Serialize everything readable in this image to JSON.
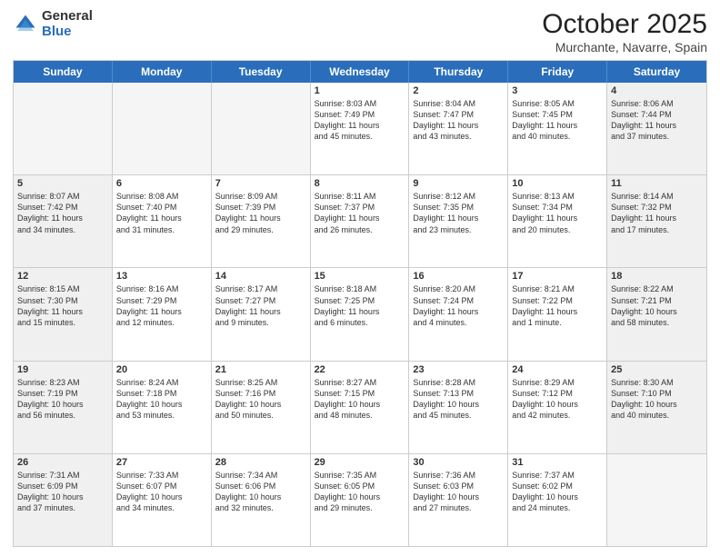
{
  "header": {
    "logo_general": "General",
    "logo_blue": "Blue",
    "title": "October 2025",
    "location": "Murchante, Navarre, Spain"
  },
  "weekdays": [
    "Sunday",
    "Monday",
    "Tuesday",
    "Wednesday",
    "Thursday",
    "Friday",
    "Saturday"
  ],
  "rows": [
    [
      {
        "day": "",
        "text": "",
        "empty": true
      },
      {
        "day": "",
        "text": "",
        "empty": true
      },
      {
        "day": "",
        "text": "",
        "empty": true
      },
      {
        "day": "1",
        "text": "Sunrise: 8:03 AM\nSunset: 7:49 PM\nDaylight: 11 hours\nand 45 minutes.",
        "empty": false
      },
      {
        "day": "2",
        "text": "Sunrise: 8:04 AM\nSunset: 7:47 PM\nDaylight: 11 hours\nand 43 minutes.",
        "empty": false
      },
      {
        "day": "3",
        "text": "Sunrise: 8:05 AM\nSunset: 7:45 PM\nDaylight: 11 hours\nand 40 minutes.",
        "empty": false
      },
      {
        "day": "4",
        "text": "Sunrise: 8:06 AM\nSunset: 7:44 PM\nDaylight: 11 hours\nand 37 minutes.",
        "empty": false,
        "shaded": true
      }
    ],
    [
      {
        "day": "5",
        "text": "Sunrise: 8:07 AM\nSunset: 7:42 PM\nDaylight: 11 hours\nand 34 minutes.",
        "empty": false,
        "shaded": true
      },
      {
        "day": "6",
        "text": "Sunrise: 8:08 AM\nSunset: 7:40 PM\nDaylight: 11 hours\nand 31 minutes.",
        "empty": false
      },
      {
        "day": "7",
        "text": "Sunrise: 8:09 AM\nSunset: 7:39 PM\nDaylight: 11 hours\nand 29 minutes.",
        "empty": false
      },
      {
        "day": "8",
        "text": "Sunrise: 8:11 AM\nSunset: 7:37 PM\nDaylight: 11 hours\nand 26 minutes.",
        "empty": false
      },
      {
        "day": "9",
        "text": "Sunrise: 8:12 AM\nSunset: 7:35 PM\nDaylight: 11 hours\nand 23 minutes.",
        "empty": false
      },
      {
        "day": "10",
        "text": "Sunrise: 8:13 AM\nSunset: 7:34 PM\nDaylight: 11 hours\nand 20 minutes.",
        "empty": false
      },
      {
        "day": "11",
        "text": "Sunrise: 8:14 AM\nSunset: 7:32 PM\nDaylight: 11 hours\nand 17 minutes.",
        "empty": false,
        "shaded": true
      }
    ],
    [
      {
        "day": "12",
        "text": "Sunrise: 8:15 AM\nSunset: 7:30 PM\nDaylight: 11 hours\nand 15 minutes.",
        "empty": false,
        "shaded": true
      },
      {
        "day": "13",
        "text": "Sunrise: 8:16 AM\nSunset: 7:29 PM\nDaylight: 11 hours\nand 12 minutes.",
        "empty": false
      },
      {
        "day": "14",
        "text": "Sunrise: 8:17 AM\nSunset: 7:27 PM\nDaylight: 11 hours\nand 9 minutes.",
        "empty": false
      },
      {
        "day": "15",
        "text": "Sunrise: 8:18 AM\nSunset: 7:25 PM\nDaylight: 11 hours\nand 6 minutes.",
        "empty": false
      },
      {
        "day": "16",
        "text": "Sunrise: 8:20 AM\nSunset: 7:24 PM\nDaylight: 11 hours\nand 4 minutes.",
        "empty": false
      },
      {
        "day": "17",
        "text": "Sunrise: 8:21 AM\nSunset: 7:22 PM\nDaylight: 11 hours\nand 1 minute.",
        "empty": false
      },
      {
        "day": "18",
        "text": "Sunrise: 8:22 AM\nSunset: 7:21 PM\nDaylight: 10 hours\nand 58 minutes.",
        "empty": false,
        "shaded": true
      }
    ],
    [
      {
        "day": "19",
        "text": "Sunrise: 8:23 AM\nSunset: 7:19 PM\nDaylight: 10 hours\nand 56 minutes.",
        "empty": false,
        "shaded": true
      },
      {
        "day": "20",
        "text": "Sunrise: 8:24 AM\nSunset: 7:18 PM\nDaylight: 10 hours\nand 53 minutes.",
        "empty": false
      },
      {
        "day": "21",
        "text": "Sunrise: 8:25 AM\nSunset: 7:16 PM\nDaylight: 10 hours\nand 50 minutes.",
        "empty": false
      },
      {
        "day": "22",
        "text": "Sunrise: 8:27 AM\nSunset: 7:15 PM\nDaylight: 10 hours\nand 48 minutes.",
        "empty": false
      },
      {
        "day": "23",
        "text": "Sunrise: 8:28 AM\nSunset: 7:13 PM\nDaylight: 10 hours\nand 45 minutes.",
        "empty": false
      },
      {
        "day": "24",
        "text": "Sunrise: 8:29 AM\nSunset: 7:12 PM\nDaylight: 10 hours\nand 42 minutes.",
        "empty": false
      },
      {
        "day": "25",
        "text": "Sunrise: 8:30 AM\nSunset: 7:10 PM\nDaylight: 10 hours\nand 40 minutes.",
        "empty": false,
        "shaded": true
      }
    ],
    [
      {
        "day": "26",
        "text": "Sunrise: 7:31 AM\nSunset: 6:09 PM\nDaylight: 10 hours\nand 37 minutes.",
        "empty": false,
        "shaded": true
      },
      {
        "day": "27",
        "text": "Sunrise: 7:33 AM\nSunset: 6:07 PM\nDaylight: 10 hours\nand 34 minutes.",
        "empty": false
      },
      {
        "day": "28",
        "text": "Sunrise: 7:34 AM\nSunset: 6:06 PM\nDaylight: 10 hours\nand 32 minutes.",
        "empty": false
      },
      {
        "day": "29",
        "text": "Sunrise: 7:35 AM\nSunset: 6:05 PM\nDaylight: 10 hours\nand 29 minutes.",
        "empty": false
      },
      {
        "day": "30",
        "text": "Sunrise: 7:36 AM\nSunset: 6:03 PM\nDaylight: 10 hours\nand 27 minutes.",
        "empty": false
      },
      {
        "day": "31",
        "text": "Sunrise: 7:37 AM\nSunset: 6:02 PM\nDaylight: 10 hours\nand 24 minutes.",
        "empty": false
      },
      {
        "day": "",
        "text": "",
        "empty": true,
        "shaded": true
      }
    ]
  ]
}
